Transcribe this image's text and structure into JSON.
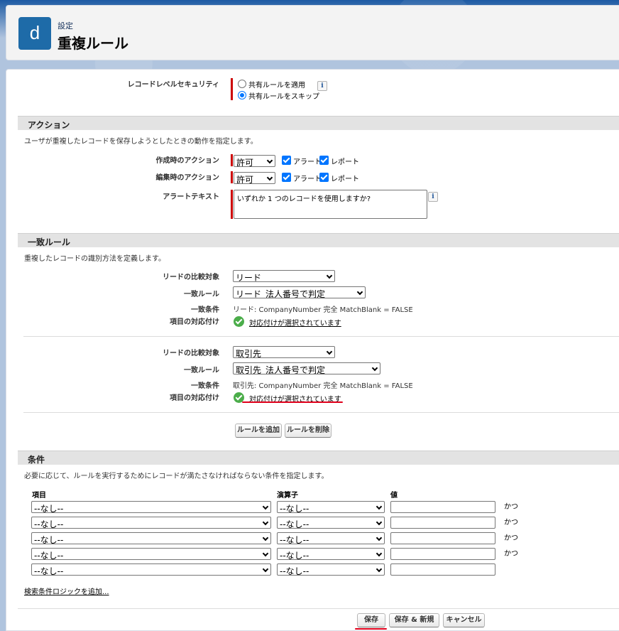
{
  "header": {
    "logo_letter": "d",
    "breadcrumb": "設定",
    "title": "重複ルール"
  },
  "security": {
    "label": "レコードレベルセキュリティ",
    "options": [
      "共有ルールを適用",
      "共有ルールをスキップ"
    ],
    "selected_index": 1
  },
  "action_section": {
    "title": "アクション",
    "description": "ユーザが重複したレコードを保存しようとしたときの動作を指定します。",
    "on_create": {
      "label": "作成時のアクション",
      "value": "許可",
      "alert": "アラート",
      "report": "レポート"
    },
    "on_edit": {
      "label": "編集時のアクション",
      "value": "許可",
      "alert": "アラート",
      "report": "レポート"
    },
    "alert_text": {
      "label": "アラートテキスト",
      "value": "いずれか 1 つのレコードを使用しますか?"
    }
  },
  "matching_section": {
    "title": "一致ルール",
    "description": "重複したレコードの識別方法を定義します。",
    "rules": [
      {
        "compare_label": "リードの比較対象",
        "compare_value": "リード",
        "rule_label": "一致ルール",
        "rule_value": "リード_法人番号で判定",
        "criteria_label": "一致条件",
        "criteria_value": "リード: CompanyNumber 完全 MatchBlank = FALSE",
        "mapping_label": "項目の対応付け",
        "mapping_value": "対応付けが選択されています"
      },
      {
        "compare_label": "リードの比較対象",
        "compare_value": "取引先",
        "rule_label": "一致ルール",
        "rule_value": "取引先_法人番号で判定",
        "criteria_label": "一致条件",
        "criteria_value": "取引先: CompanyNumber 完全 MatchBlank = FALSE",
        "mapping_label": "項目の対応付け",
        "mapping_value": "対応付けが選択されています"
      }
    ],
    "add_rule": "ルールを追加",
    "remove_rule": "ルールを削除"
  },
  "conditions_section": {
    "title": "条件",
    "description": "必要に応じて、ルールを実行するためにレコードが満たさなければならない条件を指定します。",
    "col_field": "項目",
    "col_operator": "演算子",
    "col_value": "値",
    "rows": [
      {
        "field": "--なし--",
        "operator": "--なし--",
        "value": "",
        "conj": "かつ"
      },
      {
        "field": "--なし--",
        "operator": "--なし--",
        "value": "",
        "conj": "かつ"
      },
      {
        "field": "--なし--",
        "operator": "--なし--",
        "value": "",
        "conj": "かつ"
      },
      {
        "field": "--なし--",
        "operator": "--なし--",
        "value": "",
        "conj": "かつ"
      },
      {
        "field": "--なし--",
        "operator": "--なし--",
        "value": "",
        "conj": ""
      }
    ],
    "add_logic": "検索条件ロジックを追加..."
  },
  "footer": {
    "save": "保存",
    "save_new": "保存 & 新規",
    "cancel": "キャンセル"
  },
  "colors": {
    "accent": "#1e6ba8",
    "required": "#cc0000",
    "annotation_red": "#e0001b",
    "success": "#4bad4a"
  }
}
